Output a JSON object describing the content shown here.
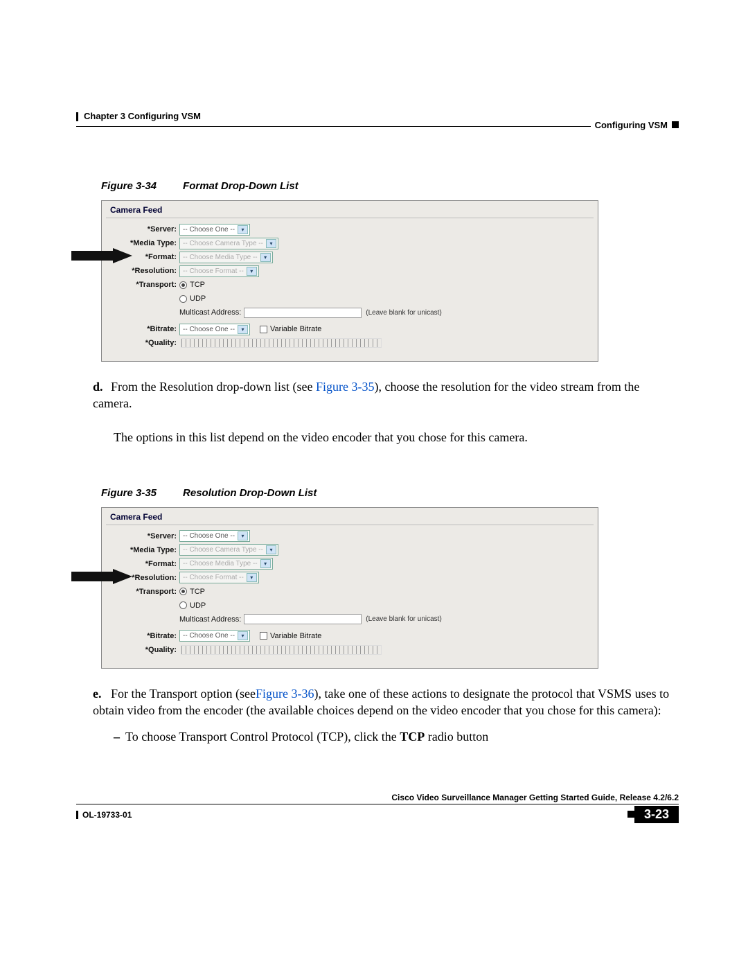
{
  "header": {
    "left": "Chapter 3    Configuring VSM",
    "right": "Configuring VSM"
  },
  "fig34": {
    "caption_num": "Figure 3-34",
    "caption_title": "Format Drop-Down List"
  },
  "fig35": {
    "caption_num": "Figure 3-35",
    "caption_title": "Resolution Drop-Down List"
  },
  "camera_feed": {
    "legend": "Camera Feed",
    "labels": {
      "server": "*Server:",
      "media_type": "*Media Type:",
      "format": "*Format:",
      "resolution": "*Resolution:",
      "transport": "*Transport:",
      "bitrate": "*Bitrate:",
      "quality": "*Quality:",
      "multicast": "Multicast Address:"
    },
    "selects": {
      "choose_one": "-- Choose One --",
      "choose_camera": "-- Choose Camera Type --",
      "choose_media": "-- Choose Media Type --",
      "choose_format": "-- Choose Format --"
    },
    "tcp": "TCP",
    "udp": "UDP",
    "unicast_hint": "(Leave blank for unicast)",
    "variable_bitrate": "Variable Bitrate"
  },
  "text": {
    "d_marker": "d.",
    "d_line1a": "From the Resolution drop-down list (see ",
    "d_link": "Figure 3-35",
    "d_line1b": "), choose the resolution for the video stream from the camera.",
    "d_line2": "The options in this list depend on the video encoder that you chose for this camera.",
    "e_marker": "e.",
    "e_line1a": "For the Transport option (see",
    "e_link": "Figure 3-36",
    "e_line1b": "), take one of these actions to designate the protocol that VSMS uses to obtain video from the encoder (the available choices depend on the video encoder that you chose for this camera):",
    "bullet1a": "To choose Transport Control Protocol (TCP), click the ",
    "bullet1_bold": "TCP",
    "bullet1b": " radio button"
  },
  "footer": {
    "book": "Cisco Video Surveillance Manager Getting Started Guide, Release 4.2/6.2",
    "docnum": "OL-19733-01",
    "page": "3-23"
  }
}
